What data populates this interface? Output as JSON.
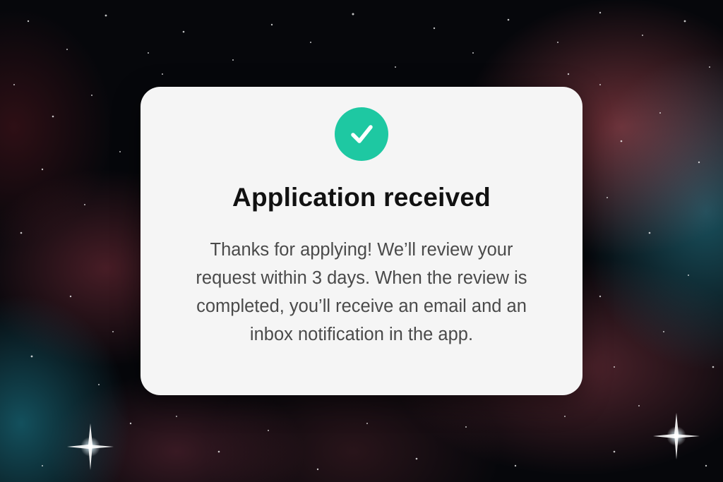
{
  "dialog": {
    "title": "Application received",
    "message_lines": [
      "Thanks for applying! We’ll review your",
      "request within 3 days. When the review is",
      "completed, you’ll receive an email and an",
      "inbox notification in the app."
    ],
    "status_icon": "check-circle-icon"
  },
  "colors": {
    "card_background": "#f5f5f5",
    "success_accent": "#1ec8a2",
    "title_text": "#111111",
    "body_text": "#4a4a4a",
    "backdrop": "#06070b"
  }
}
